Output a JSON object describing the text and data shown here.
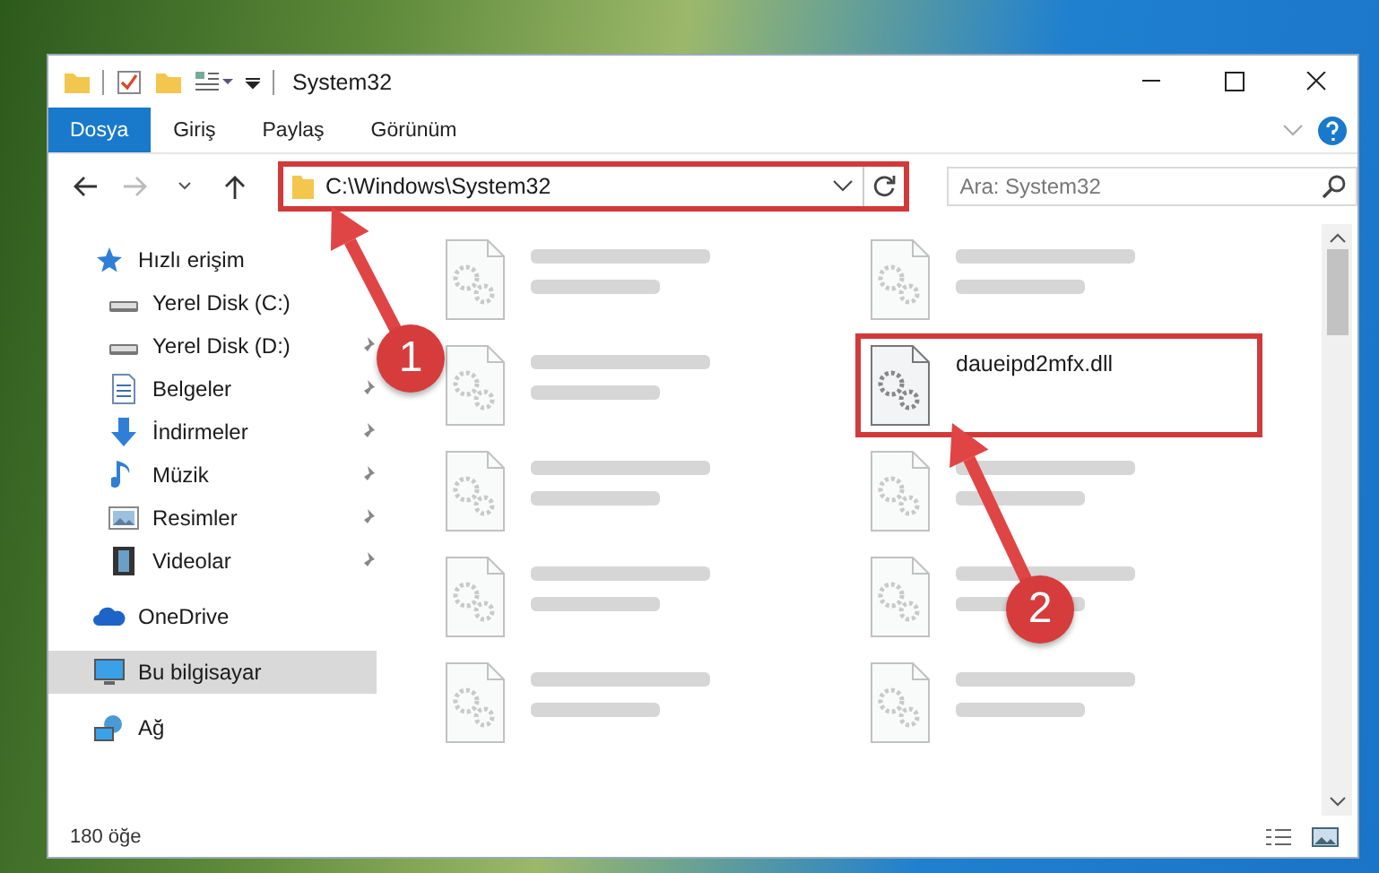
{
  "window": {
    "title": "System32"
  },
  "ribbon_tabs": [
    {
      "label": "Dosya",
      "kind": "file"
    },
    {
      "label": "Giriş",
      "kind": "tab"
    },
    {
      "label": "Paylaş",
      "kind": "tab"
    },
    {
      "label": "Görünüm",
      "kind": "tab"
    }
  ],
  "address": {
    "path": "C:\\Windows\\System32",
    "highlighted": true
  },
  "search": {
    "placeholder": "Ara: System32"
  },
  "sidebar": {
    "items": [
      {
        "label": "Hızlı erişim",
        "kind": "quick",
        "selected": false,
        "children": [
          {
            "label": "Yerel Disk (C:)",
            "kind": "drive",
            "pinned": false
          },
          {
            "label": "Yerel Disk (D:)",
            "kind": "drive",
            "pinned": true
          },
          {
            "label": "Belgeler",
            "kind": "documents",
            "pinned": true
          },
          {
            "label": "İndirmeler",
            "kind": "downloads",
            "pinned": true
          },
          {
            "label": "Müzik",
            "kind": "music",
            "pinned": true
          },
          {
            "label": "Resimler",
            "kind": "pictures",
            "pinned": true
          },
          {
            "label": "Videolar",
            "kind": "videos",
            "pinned": true
          }
        ]
      },
      {
        "label": "OneDrive",
        "kind": "cloud",
        "selected": false
      },
      {
        "label": "Bu bilgisayar",
        "kind": "computer",
        "selected": true
      },
      {
        "label": "Ağ",
        "kind": "network",
        "selected": false
      }
    ]
  },
  "files": [
    {
      "blurred": true
    },
    {
      "blurred": true
    },
    {
      "blurred": true
    },
    {
      "name": "daueipd2mfx.dll",
      "blurred": false,
      "highlighted": true
    },
    {
      "blurred": true
    },
    {
      "blurred": true
    },
    {
      "blurred": true
    },
    {
      "blurred": true
    },
    {
      "blurred": true
    },
    {
      "blurred": true
    }
  ],
  "annotations": [
    {
      "number": "1"
    },
    {
      "number": "2"
    }
  ],
  "status_bar": {
    "count": "180 öğe"
  }
}
